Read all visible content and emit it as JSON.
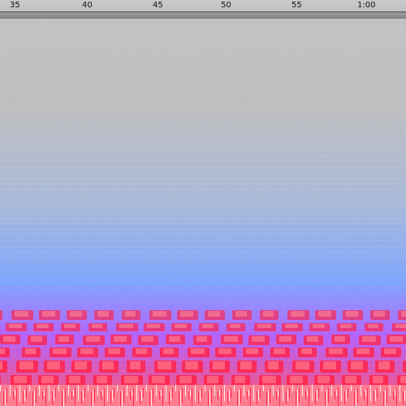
{
  "window": {
    "view": "spectrogram"
  },
  "timeline": {
    "labels": [
      "35",
      "40",
      "45",
      "50",
      "55",
      "1:00"
    ]
  },
  "spectrogram": {
    "colors": {
      "background": "#c0c0c0",
      "blue": "#5a91ff",
      "magenta": "#c72cff",
      "red": "#ff1d45",
      "pink": "#ff8a96",
      "white": "#fff4f4"
    }
  }
}
